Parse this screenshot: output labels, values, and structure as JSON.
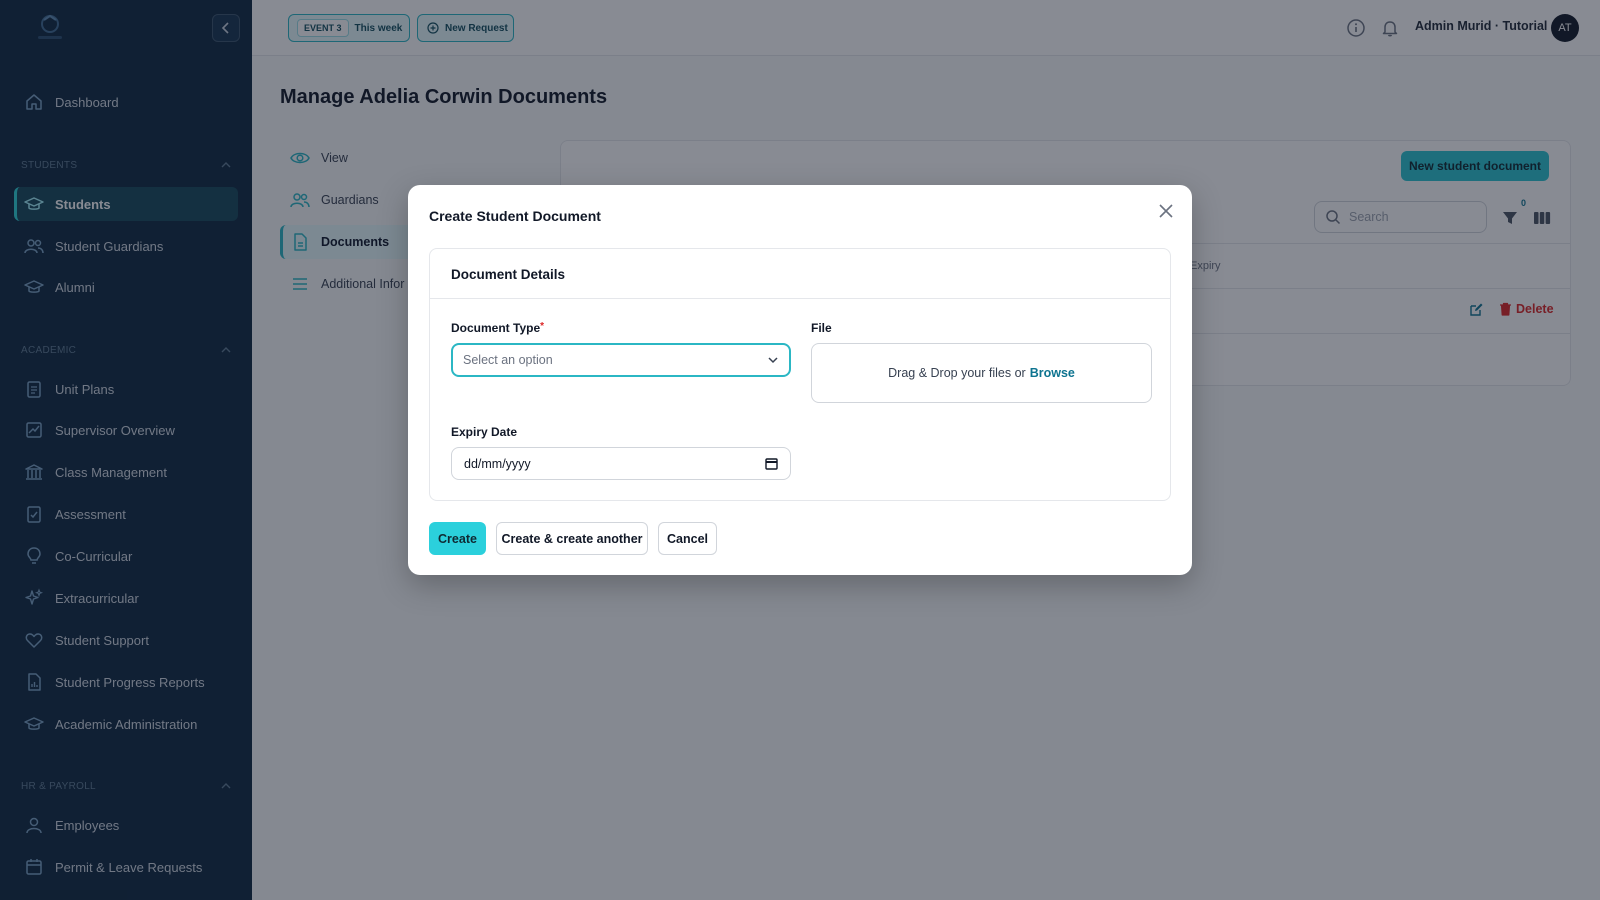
{
  "topbar": {
    "event_tag": "EVENT 3",
    "event_period": "This week",
    "new_request": "New Request",
    "user_name": "Admin Murid · Tutorial",
    "avatar_initials": "AT"
  },
  "sidebar": {
    "logo_icon": "school-logo-icon",
    "dashboard": "Dashboard",
    "groups": {
      "students": "STUDENTS",
      "academic": "ACADEMIC",
      "hr": "HR & PAYROLL"
    },
    "items": {
      "students": "Students",
      "student_guardians": "Student Guardians",
      "alumni": "Alumni",
      "unit_plans": "Unit Plans",
      "supervisor_overview": "Supervisor Overview",
      "class_management": "Class Management",
      "assessment": "Assessment",
      "co_curricular": "Co-Curricular",
      "extracurricular": "Extracurricular",
      "student_support": "Student Support",
      "student_progress_reports": "Student Progress Reports",
      "academic_administration": "Academic Administration",
      "employees": "Employees",
      "permit_leave": "Permit & Leave Requests"
    }
  },
  "page": {
    "title": "Manage Adelia Corwin Documents",
    "subnav": {
      "view": "View",
      "guardians": "Guardians",
      "documents": "Documents",
      "additional": "Additional Infor"
    },
    "new_button": "New student document",
    "search_placeholder": "Search",
    "filter_count": "0",
    "column_expiry": "Expiry",
    "delete_label": "Delete"
  },
  "modal": {
    "title": "Create Student Document",
    "section_title": "Document Details",
    "document_type_label": "Document Type",
    "document_type_required": "*",
    "document_type_placeholder": "Select an option",
    "file_label": "File",
    "dropzone_text": "Drag & Drop your files or",
    "dropzone_browse": "Browse",
    "expiry_label": "Expiry Date",
    "expiry_placeholder": "dd/mm/yyyy",
    "create": "Create",
    "create_another": "Create & create another",
    "cancel": "Cancel"
  },
  "colors": {
    "sidebar_bg": "#0f2940",
    "accent": "#2bc4d0",
    "danger": "#dc2626"
  }
}
